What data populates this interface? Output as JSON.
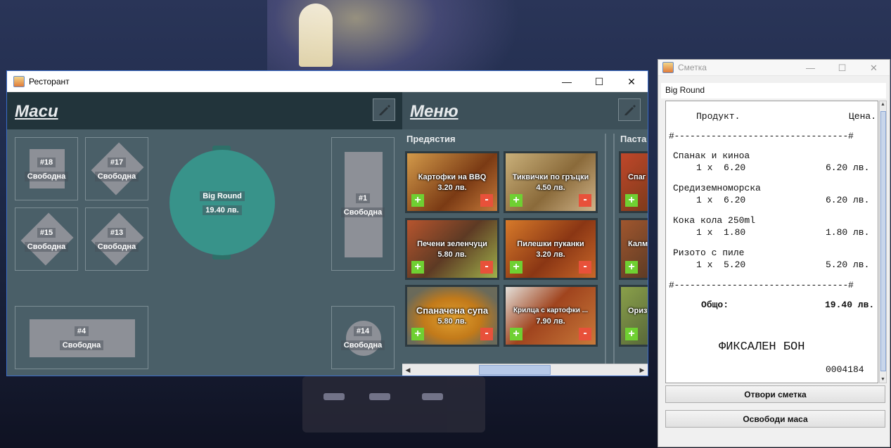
{
  "main_window": {
    "title": "Ресторант",
    "controls": {
      "minimize": "—",
      "maximize": "☐",
      "close": "✕"
    }
  },
  "tables_pane": {
    "title": "Маси",
    "tables": [
      {
        "number": "#18",
        "status": "Свободна"
      },
      {
        "number": "#17",
        "status": "Свободна"
      },
      {
        "number": "#15",
        "status": "Свободна"
      },
      {
        "number": "#13",
        "status": "Свободна"
      },
      {
        "number": "#4",
        "status": "Свободна"
      },
      {
        "number": "#1",
        "status": "Свободна"
      },
      {
        "number": "#14",
        "status": "Свободна"
      }
    ],
    "big_round": {
      "name": "Big Round",
      "total": "19.40 лв."
    }
  },
  "menu_pane": {
    "title": "Меню",
    "categories": [
      {
        "name": "Предястия",
        "items": [
          {
            "name": "Картофки на BBQ",
            "price": "3.20 лв.",
            "bg": "#b56b2a"
          },
          {
            "name": "Тиквички по гръцки",
            "price": "4.50 лв.",
            "bg": "#a88a5a"
          },
          {
            "name": "Печени зеленчуци",
            "price": "5.80 лв.",
            "bg": "#8f4e2e"
          },
          {
            "name": "Пилешки пуканки",
            "price": "3.20 лв.",
            "bg": "#b85e22"
          },
          {
            "name": "Спаначена супа",
            "price": "5.80 лв.",
            "bg": "#c8872a"
          },
          {
            "name": "Крилца с картофки ...",
            "price": "7.90 лв.",
            "bg": "#8a3a22"
          }
        ]
      },
      {
        "name": "Паста",
        "items": [
          {
            "name": "Спаг",
            "price": "",
            "bg": "#8a4a2a"
          },
          {
            "name": "Калм",
            "price": "",
            "bg": "#7a5030"
          },
          {
            "name": "Ориз",
            "price": "",
            "bg": "#6a7a3a"
          }
        ]
      }
    ],
    "plus_label": "+",
    "minus_label": "-"
  },
  "bill_window": {
    "title": "Сметка",
    "table_name": "Big Round",
    "receipt": {
      "header_product": "Продукт.",
      "header_price": "Цена.",
      "separator": "#---------------------------------#",
      "lines": [
        {
          "product": "Спанак и киноа",
          "qty": "1 x  6.20",
          "sum": "6.20 лв."
        },
        {
          "product": "Средиземноморска",
          "qty": "1 x  6.20",
          "sum": "6.20 лв."
        },
        {
          "product": "Кока кола 250ml",
          "qty": "1 x  1.80",
          "sum": "1.80 лв."
        },
        {
          "product": "Ризото с пиле",
          "qty": "1 x  5.20",
          "sum": "5.20 лв."
        }
      ],
      "total_label": "Общо:",
      "total_value": "19.40 лв.",
      "fiscal": "ФИКСАЛЕН БОН",
      "number": "0004184"
    },
    "open_bill_button": "Отвори сметка",
    "free_table_button": "Освободи маса"
  }
}
